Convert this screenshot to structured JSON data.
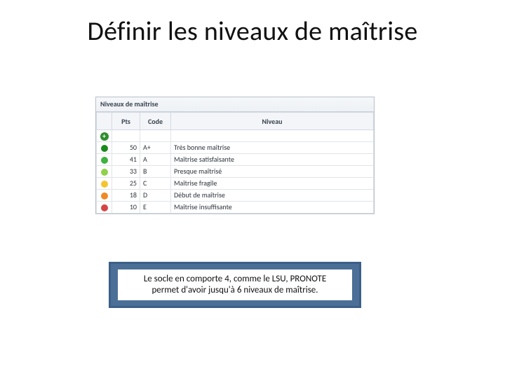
{
  "title": "Définir les niveaux de maîtrise",
  "panel": {
    "header": "Niveaux de maîtrise",
    "columns": {
      "pts": "Pts",
      "code": "Code",
      "niveau": "Niveau"
    },
    "add_glyph": "+",
    "rows": [
      {
        "color": "#1a8a1a",
        "pts": "50",
        "code": "A+",
        "niveau": "Très bonne maîtrise"
      },
      {
        "color": "#3fb23f",
        "pts": "41",
        "code": "A",
        "niveau": "Maîtrise satisfaisante"
      },
      {
        "color": "#8fd24a",
        "pts": "33",
        "code": "B",
        "niveau": "Presque maîtrisé"
      },
      {
        "color": "#f4c430",
        "pts": "25",
        "code": "C",
        "niveau": "Maîtrise fragile"
      },
      {
        "color": "#f08a24",
        "pts": "18",
        "code": "D",
        "niveau": "Début de maîtrise"
      },
      {
        "color": "#d64545",
        "pts": "10",
        "code": "E",
        "niveau": "Maîtrise insuffisante"
      }
    ]
  },
  "note": {
    "line1": "Le socle en comporte 4, comme le LSU, PRONOTE",
    "line2": "permet d'avoir jusqu'à 6 niveaux de maîtrise."
  }
}
